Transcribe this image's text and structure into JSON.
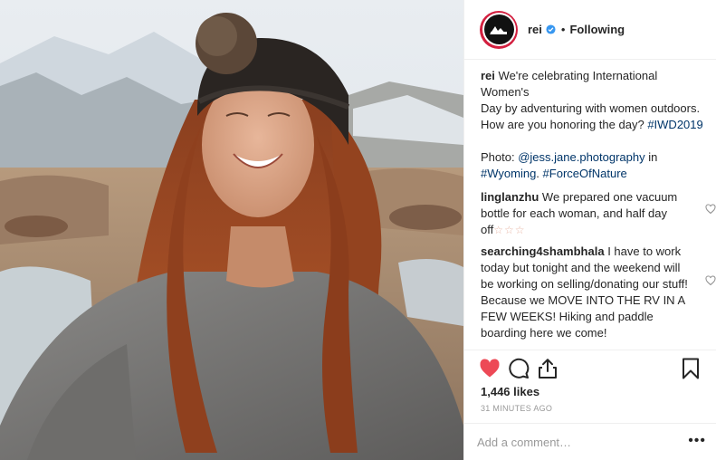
{
  "post": {
    "author": "rei",
    "follow_status": "Following",
    "separator": "•",
    "caption": {
      "username": "rei",
      "lines": [
        "We're celebrating International Women's",
        "Day by adventuring with women outdoors.",
        "How are you honoring the day?"
      ],
      "hashtag_iwd": "#IWD2019",
      "photo_label": "Photo:",
      "photo_handle": "@jess.jane.photography",
      "in_word": "in",
      "hashtag_wyoming": "#Wyoming",
      "dot": ".",
      "hashtag_force": "#ForceOfNature"
    },
    "comments": [
      {
        "username": "linglanzhu",
        "text": "We prepared one vacuum bottle for each woman, and half day off",
        "emoji": "☆☆☆"
      },
      {
        "username": "searching4shambhala",
        "text": "I have to work today but tonight and the weekend will be working on selling/donating our stuff! Because we MOVE INTO THE RV IN A FEW WEEKS! Hiking and paddle boarding here we come!"
      }
    ],
    "likes": "1,446 likes",
    "time_ago": "31 MINUTES AGO",
    "comment_placeholder": "Add a comment…",
    "more_label": "•••"
  },
  "icons": {
    "like": "heart-icon-filled",
    "comment": "comment-bubble-icon",
    "share": "share-icon",
    "save": "bookmark-icon",
    "comment_like": "heart-outline-icon",
    "verified": "verified-badge-icon"
  },
  "colors": {
    "like_red": "#ed4956",
    "link_blue": "#003569",
    "muted_gray": "#999999",
    "avatar_ring": "#d31f3f"
  }
}
